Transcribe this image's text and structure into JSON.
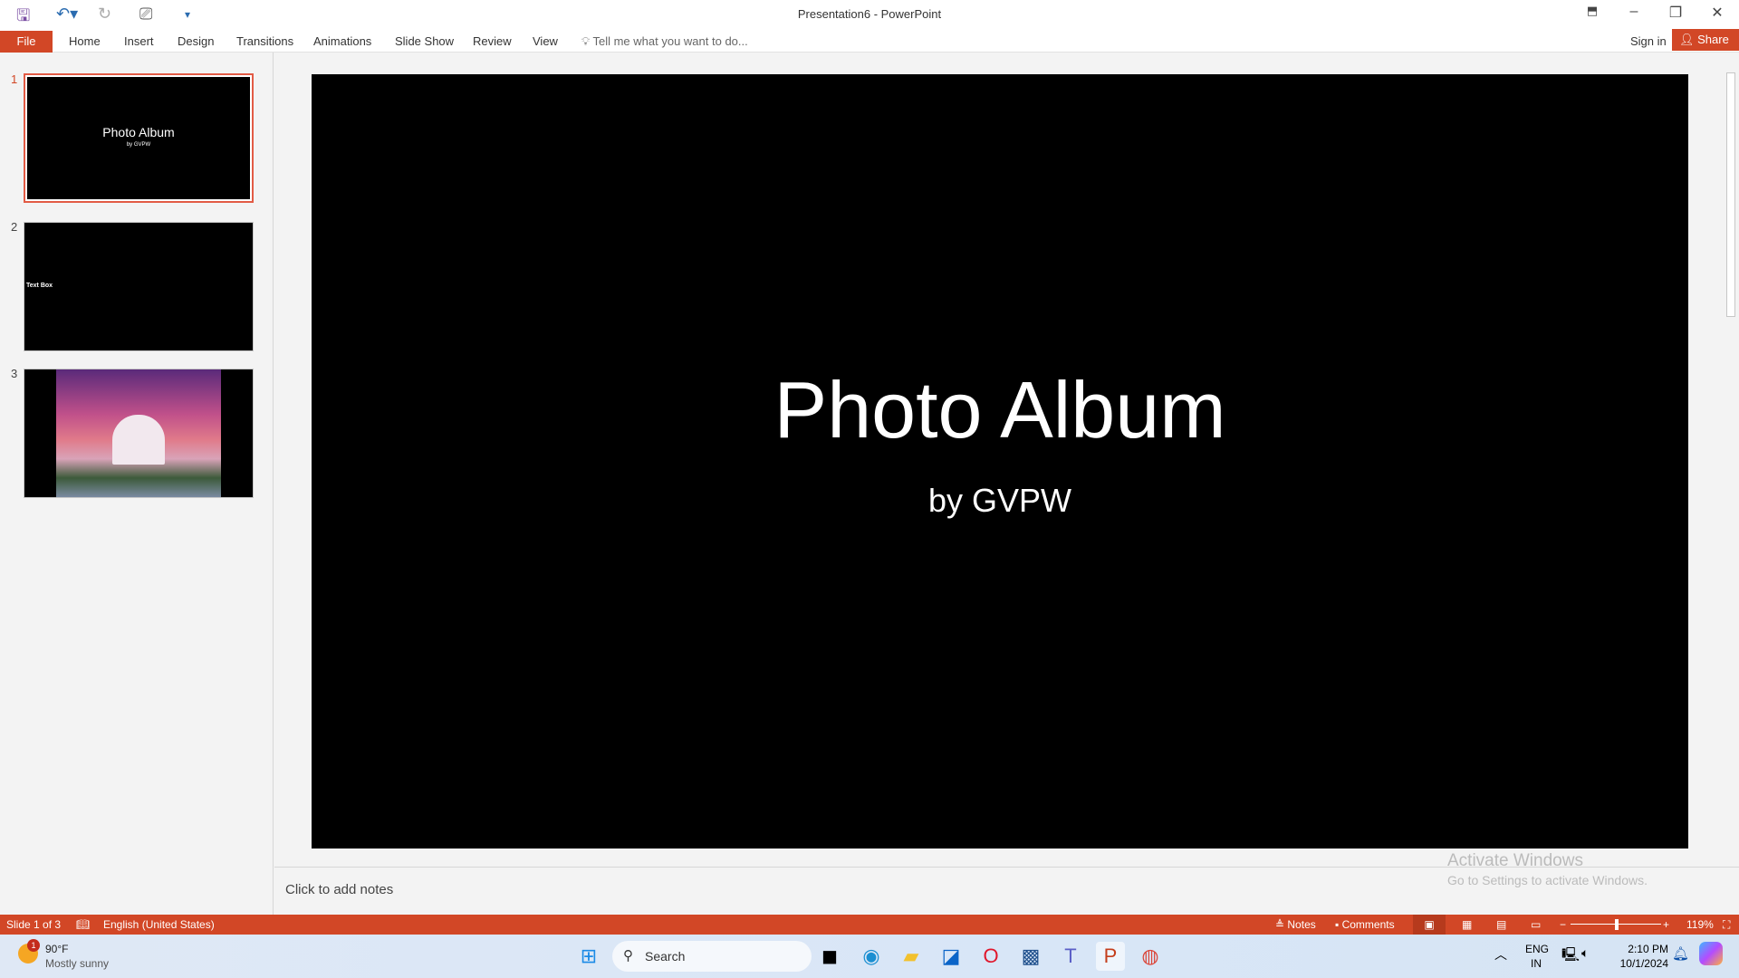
{
  "window": {
    "title": "Presentation6 - PowerPoint"
  },
  "ribbon": {
    "file": "File",
    "tabs": [
      "Home",
      "Insert",
      "Design",
      "Transitions",
      "Animations",
      "Slide Show",
      "Review",
      "View"
    ],
    "tell_me": "Tell me what you want to do...",
    "sign_in": "Sign in",
    "share": "Share"
  },
  "thumbnails": [
    {
      "num": "1",
      "title": "Photo Album",
      "sub": "by GVPW"
    },
    {
      "num": "2",
      "text": "Text Box"
    },
    {
      "num": "3"
    }
  ],
  "slide": {
    "title": "Photo Album",
    "subtitle": "by GVPW"
  },
  "notes": {
    "placeholder": "Click to add notes"
  },
  "watermark": {
    "line1": "Activate Windows",
    "line2": "Go to Settings to activate Windows."
  },
  "status": {
    "slide": "Slide 1 of 3",
    "language": "English (United States)",
    "notes": "Notes",
    "comments": "Comments",
    "zoom": "119%",
    "zoom_percent": 119
  },
  "taskbar": {
    "weather_temp": "90°F",
    "weather_desc": "Mostly sunny",
    "weather_badge": "1",
    "search": "Search",
    "lang1": "ENG",
    "lang2": "IN",
    "time": "2:10 PM",
    "date": "10/1/2024"
  },
  "colors": {
    "accent": "#d24726"
  }
}
